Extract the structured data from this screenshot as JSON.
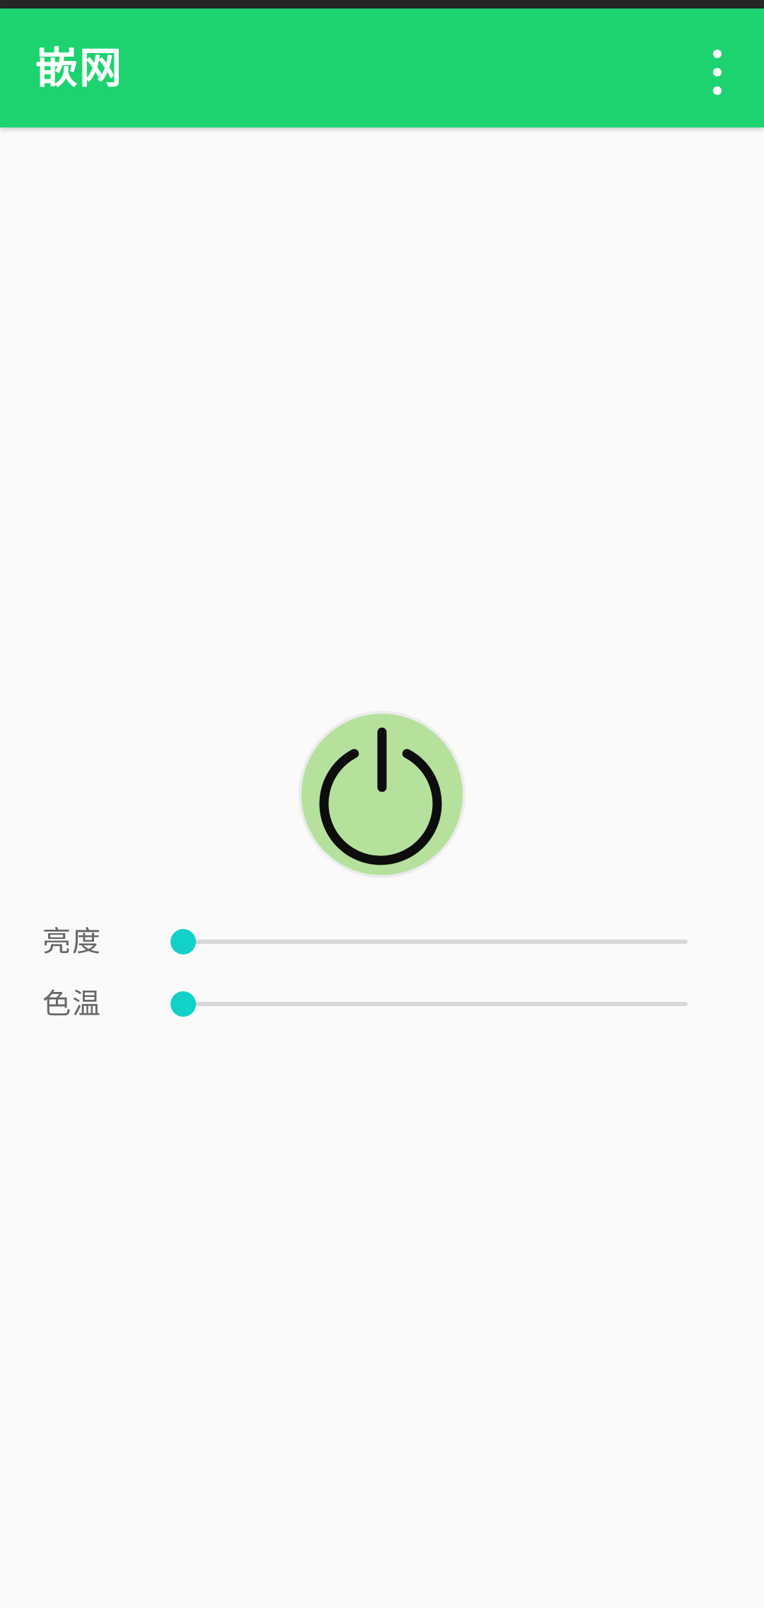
{
  "app_bar": {
    "title": "嵌网",
    "menu_icon": "more-vert-icon",
    "color": "#1dd36f"
  },
  "power": {
    "icon": "power-icon",
    "background": "#b5e19d"
  },
  "sliders": [
    {
      "label": "亮度",
      "value": 0
    },
    {
      "label": "色温",
      "value": 0
    }
  ],
  "colors": {
    "accent": "#12d1c8",
    "track": "#d7d7d7"
  }
}
